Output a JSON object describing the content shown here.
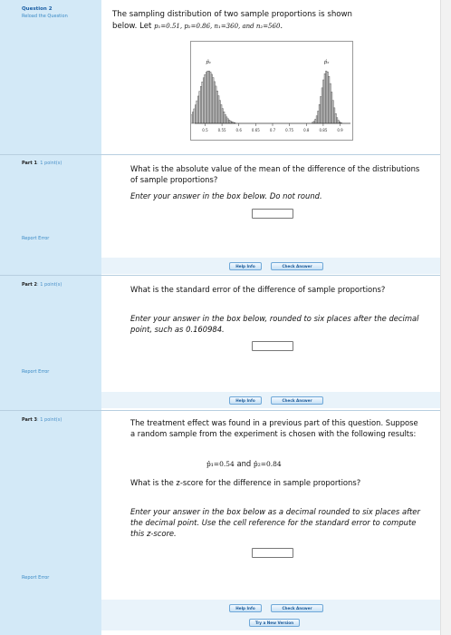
{
  "sidebar": {
    "question_label": "Question 2",
    "reload_label": "Reload the Question",
    "parts": [
      {
        "label": "Part 1",
        "points": ": 1  point(s)"
      },
      {
        "label": "Part 2",
        "points": ": 1  point(s)"
      },
      {
        "label": "Part 3",
        "points": ": 1  point(s)"
      }
    ],
    "report_error": "Report Error"
  },
  "intro": {
    "line1": "The sampling distribution of two sample proportions is shown",
    "line2_prefix": "below.  Let",
    "params": "p₁=0.51,  p₂=0.86,  n₁=360,  and  n₂=560",
    "line2_suffix": "."
  },
  "chart_data": {
    "type": "bar",
    "title": "",
    "xlabel": "",
    "ylabel": "",
    "xticks": [
      "0.5",
      "0.55",
      "0.6",
      "0.65",
      "0.7",
      "0.75",
      "0.8",
      "0.85",
      "0.9"
    ],
    "x_tick_values": [
      0.5,
      0.55,
      0.6,
      0.65,
      0.7,
      0.75,
      0.8,
      0.85,
      0.9
    ],
    "xlim": [
      0.48,
      0.92
    ],
    "series": [
      {
        "name": "p̂₁",
        "center": 0.51,
        "sd": 0.0263
      },
      {
        "name": "p̂₂",
        "center": 0.86,
        "sd": 0.0147
      }
    ],
    "label_p1": "p̂₁",
    "label_p2": "p̂₂"
  },
  "part1": {
    "question": "What is the absolute value of the mean of the difference of the distributions of sample proportions?",
    "instruction": "Enter your answer in the box below.  Do not round.",
    "answer": ""
  },
  "part2": {
    "question": "What is the standard error of the difference of sample proportions?",
    "instruction": "Enter your answer in the box below, rounded to six places after the decimal point, such as 0.160984.",
    "answer": ""
  },
  "part3": {
    "intro": "The treatment effect was found in a previous part of this question.  Suppose a random sample from the experiment is chosen with the following results:",
    "eq_p1": "p̂₁=0.54",
    "eq_and": " and ",
    "eq_p2": "p̂₂=0.84",
    "question": "What is the z-score for the difference in sample proportions?",
    "instruction": "Enter your answer in the box below as a decimal rounded to six places after the decimal point.  Use the cell reference for the standard error to compute this z-score.",
    "answer": ""
  },
  "buttons": {
    "help": "Help Info",
    "check": "Check Answer",
    "new_version": "Try a New Version"
  }
}
